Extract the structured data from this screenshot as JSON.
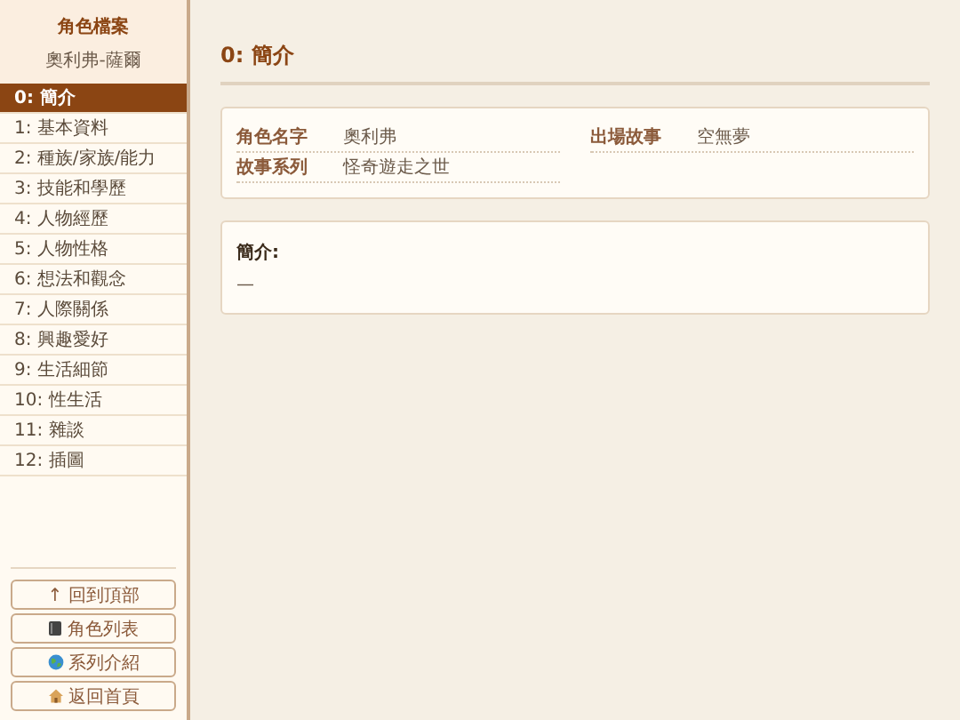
{
  "sidebar": {
    "title": "角色檔案",
    "subtitle": "奧利弗-薩爾",
    "items": [
      {
        "label": "0: 簡介",
        "selected": true
      },
      {
        "label": "1: 基本資料",
        "selected": false
      },
      {
        "label": "2: 種族/家族/能力",
        "selected": false
      },
      {
        "label": "3: 技能和學歷",
        "selected": false
      },
      {
        "label": "4: 人物經歷",
        "selected": false
      },
      {
        "label": "5: 人物性格",
        "selected": false
      },
      {
        "label": "6: 想法和觀念",
        "selected": false
      },
      {
        "label": "7: 人際關係",
        "selected": false
      },
      {
        "label": "8: 興趣愛好",
        "selected": false
      },
      {
        "label": "9: 生活細節",
        "selected": false
      },
      {
        "label": "10: 性生活",
        "selected": false
      },
      {
        "label": "11: 雜談",
        "selected": false
      },
      {
        "label": "12: 插圖",
        "selected": false
      }
    ],
    "buttons": [
      {
        "kind": "top",
        "label": "↑ 回到頂部"
      },
      {
        "kind": "list",
        "label": "角色列表"
      },
      {
        "kind": "series",
        "label": "系列介紹"
      },
      {
        "kind": "home",
        "label": "返回首頁"
      }
    ]
  },
  "main": {
    "heading": "0: 簡介",
    "fields": [
      {
        "label": "角色名字",
        "value": "奧利弗"
      },
      {
        "label": "出場故事",
        "value": "空無夢"
      },
      {
        "label": "故事系列",
        "value": "怪奇遊走之世"
      }
    ],
    "intro": {
      "title": "簡介:",
      "text": "—"
    }
  }
}
